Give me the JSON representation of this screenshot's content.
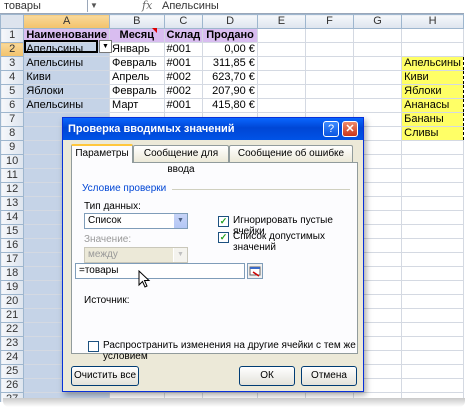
{
  "formula_bar": {
    "name_box": "товары",
    "fx": "fx",
    "value": "Апельсины"
  },
  "sheet": {
    "columns": [
      "A",
      "B",
      "C",
      "D",
      "E",
      "F",
      "G",
      "H"
    ],
    "rows": [
      "1",
      "2",
      "3",
      "4",
      "5",
      "6",
      "7",
      "8",
      "9",
      "10",
      "11",
      "12",
      "13",
      "14",
      "15",
      "16",
      "17",
      "18",
      "19",
      "20",
      "21",
      "22",
      "23",
      "24",
      "25",
      "26",
      "27"
    ],
    "table": {
      "headers": [
        "Наименование",
        "Месяц",
        "Склад",
        "Продано"
      ],
      "data": [
        [
          "Апельсины",
          "Январь",
          "#001",
          "0,00 €"
        ],
        [
          "Апельсины",
          "Февраль",
          "#001",
          "311,85 €"
        ],
        [
          "Киви",
          "Апрель",
          "#002",
          "623,70 €"
        ],
        [
          "Яблоки",
          "Февраль",
          "#002",
          "207,90 €"
        ],
        [
          "Апельсины",
          "Март",
          "#001",
          "415,80 €"
        ]
      ]
    },
    "list_h": [
      "Апельсины",
      "Киви",
      "Яблоки",
      "Ананасы",
      "Бананы",
      "Сливы"
    ]
  },
  "dialog": {
    "title": "Проверка вводимых значений",
    "help": "?",
    "close": "✕",
    "tabs": [
      "Параметры",
      "Сообщение для ввода",
      "Сообщение об ошибке"
    ],
    "section": "Условие проверки",
    "data_type_label": "Тип данных:",
    "data_type_value": "Список",
    "ignore_blank": "Игнорировать пустые ячейки",
    "dropdown_list": "Список допустимых значений",
    "value_label": "Значение:",
    "value_value": "между",
    "source_label": "Источник:",
    "source_value": "=товары",
    "apply_all": "Распространить изменения на другие ячейки с тем же условием",
    "btn_clear": "Очистить все",
    "btn_ok": "ОК",
    "btn_cancel": "Отмена"
  }
}
